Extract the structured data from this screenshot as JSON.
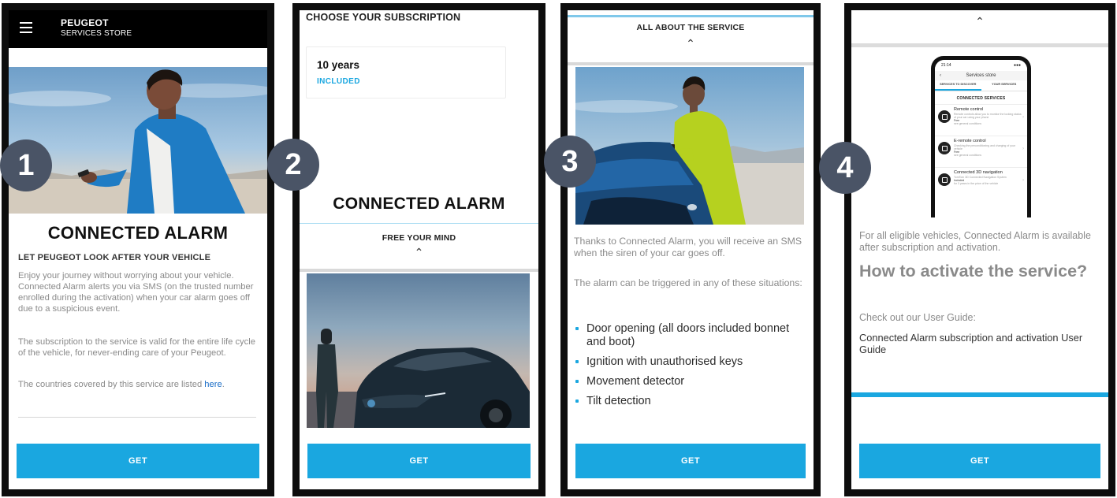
{
  "steps": [
    "1",
    "2",
    "3",
    "4"
  ],
  "common": {
    "get_label": "GET"
  },
  "screen1": {
    "brand": "PEUGEOT",
    "brand_sub": "SERVICES STORE",
    "title": "CONNECTED ALARM",
    "subtitle": "LET PEUGEOT LOOK AFTER YOUR VEHICLE",
    "para1": "Enjoy your journey without worrying about your vehicle. Connected Alarm alerts you via SMS (on the trusted number enrolled during the activation) when your car alarm goes off due to a suspicious event.",
    "para2": "The subscription to the service is valid for the entire life cycle of the vehicle, for never-ending care of your Peugeot.",
    "para3": "The countries covered by this service are listed",
    "para3_link": "here"
  },
  "screen2": {
    "heading": "CHOOSE YOUR SUBSCRIPTION",
    "years": "10 years",
    "included": "INCLUDED",
    "title": "CONNECTED ALARM",
    "section": "FREE YOUR MIND"
  },
  "screen3": {
    "heading": "ALL ABOUT THE SERVICE",
    "para1": "Thanks to Connected Alarm, you will receive an SMS when the siren of your car goes off.",
    "para2": "The alarm can be triggered in any of these situations:",
    "bullets": [
      "Door opening (all doors included bonnet and boot)",
      "Ignition with unauthorised keys",
      "Movement detector",
      "Tilt detection"
    ]
  },
  "screen4": {
    "mock": {
      "time": "21:14",
      "header": "Services store",
      "tab1": "SERVICES TO DISCOVER",
      "tab2": "YOUR SERVICES",
      "section": "CONNECTED SERVICES",
      "items": [
        {
          "title": "Remote control",
          "desc": "Remote controls allow you to monitor the locking status of your car using your phone",
          "price": "Free",
          "cond": "see general conditions"
        },
        {
          "title": "E-remote control",
          "desc": "Checking the preconditioning and charging of your vehicle",
          "price": "Free",
          "cond": "see general conditions"
        },
        {
          "title": "Connected 3D navigation",
          "desc": "TomTom 3D Connected Navigation System",
          "price": "Included",
          "cond": "for 3 years in the price of the vehicle"
        }
      ]
    },
    "para1": "For all eligible vehicles, Connected Alarm is available after subscription and activation.",
    "heading": "How to activate the service?",
    "check": "Check out our User Guide:",
    "guide": "Connected Alarm subscription and activation User Guide"
  }
}
